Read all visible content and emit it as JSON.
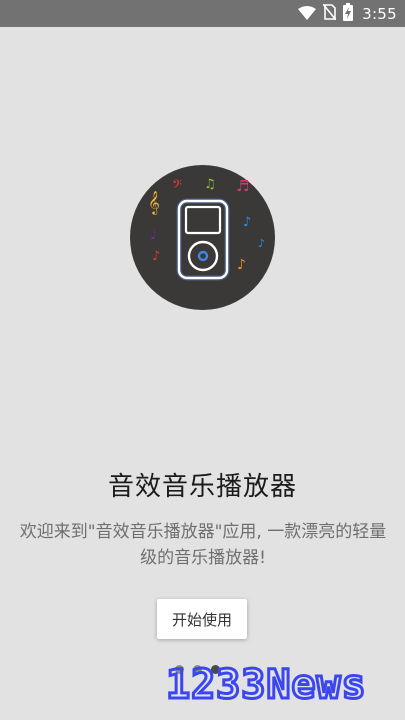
{
  "status_bar": {
    "time": "3:55",
    "icons": [
      "wifi-icon",
      "no-sim-icon",
      "battery-charging-icon"
    ]
  },
  "hero": {
    "icon": "music-player-icon",
    "decorations": [
      "treble-clef-icon",
      "bass-clef-icon",
      "music-note-icon"
    ]
  },
  "title": "音效音乐播放器",
  "description": "欢迎来到\"音效音乐播放器\"应用, 一款漂亮的轻量级的音乐播放器!",
  "start_button": {
    "label": "开始使用"
  },
  "pager": {
    "count": 3,
    "active": 3
  },
  "watermark": {
    "text": "1233News"
  },
  "colors": {
    "background": "#e2e2e2",
    "status_bar": "#727272",
    "hero_circle": "#3b3838",
    "watermark_blue": "#3c46f0"
  }
}
